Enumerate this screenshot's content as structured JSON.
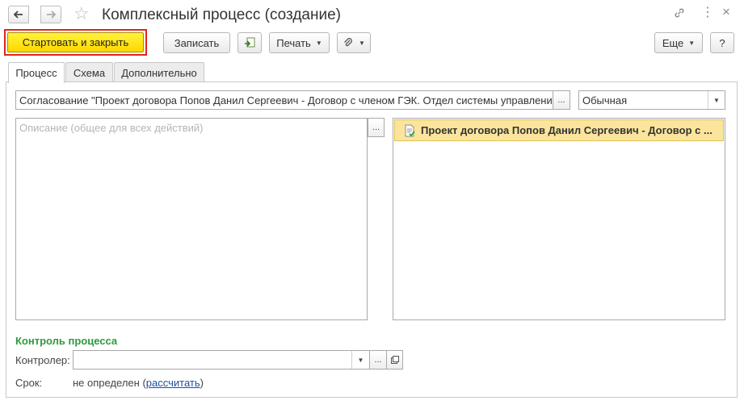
{
  "window": {
    "title": "Комплексный процесс (создание)",
    "back_icon": "arrow-left-icon",
    "forward_icon": "arrow-right-icon",
    "favorite_icon": "star-icon",
    "link_icon": "link-icon",
    "menu_icon": "more-vertical-icon",
    "close_icon": "close-icon"
  },
  "toolbar": {
    "start_close_label": "Стартовать и закрыть",
    "save_label": "Записать",
    "print_label": "Печать",
    "more_label": "Еще",
    "help_label": "?",
    "accent_color": "#ffd800",
    "highlight_border": "#e2231a"
  },
  "tabs": [
    {
      "label": "Процесс",
      "active": true
    },
    {
      "label": "Схема",
      "active": false
    },
    {
      "label": "Дополнительно",
      "active": false
    }
  ],
  "process": {
    "subject": "Согласование \"Проект договора Попов Данил Сергеевич - Договор с членом ГЭК. Отдел системы управления",
    "importance": "Обычная",
    "description_placeholder": "Описание (общее для всех действий)",
    "subjects_list": [
      {
        "label": "Проект договора Попов Данил Сергеевич - Договор с ...",
        "icon": "document-check-icon"
      }
    ]
  },
  "control": {
    "section_title": "Контроль процесса",
    "controller_label": "Контролер:",
    "controller_value": "",
    "deadline_label": "Срок:",
    "deadline_value": "не определен (",
    "deadline_link": "рассчитать",
    "deadline_close": ")",
    "section_color": "#2d9a3e"
  }
}
